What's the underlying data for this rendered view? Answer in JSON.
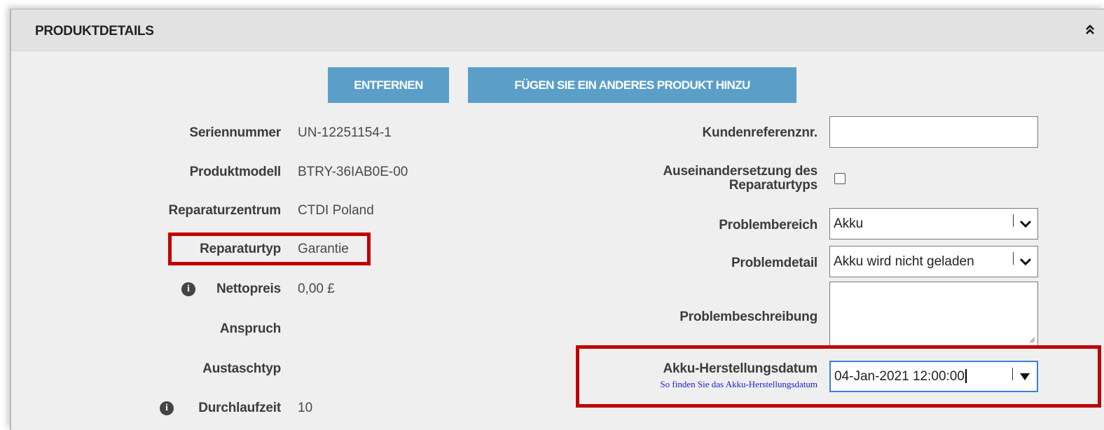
{
  "panel": {
    "title": "PRODUKTDETAILS"
  },
  "buttons": {
    "remove": "ENTFERNEN",
    "add_product": "FÜGEN SIE EIN ANDERES PRODUKT HINZU"
  },
  "left_fields": [
    {
      "label": "Seriennummer",
      "value": "UN-12251154-1"
    },
    {
      "label": "Produktmodell",
      "value": "BTRY-36IAB0E-00"
    },
    {
      "label": "Reparaturzentrum",
      "value": "CTDI Poland"
    },
    {
      "label": "Reparaturtyp",
      "value": "Garantie"
    },
    {
      "label": "Nettopreis",
      "value": "0,00 £"
    },
    {
      "label": "Anspruch",
      "value": ""
    },
    {
      "label": "Austaschtyp",
      "value": ""
    },
    {
      "label": "Durchlaufzeit",
      "value": "10"
    }
  ],
  "right_fields": {
    "customer_ref": {
      "label": "Kundenreferenznr.",
      "value": ""
    },
    "repair_dispute": {
      "label_line1": "Auseinandersetzung des",
      "label_line2": "Reparaturtyps",
      "checked": false
    },
    "problem_area": {
      "label": "Problembereich",
      "value": "Akku"
    },
    "problem_detail": {
      "label": "Problemdetail",
      "value": "Akku wird nicht geladen"
    },
    "problem_description": {
      "label": "Problembeschreibung",
      "value": ""
    },
    "battery_date": {
      "label": "Akku-Herstellungsdatum",
      "help_link": "So finden Sie das Akku-Herstellungsdatum",
      "value": "04-Jan-2021 12:00:00"
    }
  },
  "colors": {
    "button": "#5b9fc9",
    "highlight": "#c00000",
    "link": "#1a1ad6"
  }
}
